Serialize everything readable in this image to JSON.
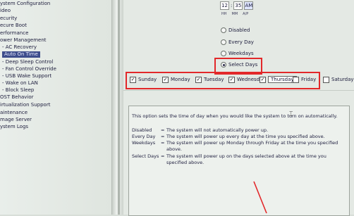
{
  "sidebar": {
    "items": [
      {
        "label": "ystem Configuration",
        "level": 0,
        "selected": false
      },
      {
        "label": "ideo",
        "level": 0,
        "selected": false
      },
      {
        "label": "ecurity",
        "level": 0,
        "selected": false
      },
      {
        "label": "ecure Boot",
        "level": 0,
        "selected": false
      },
      {
        "label": "erformance",
        "level": 0,
        "selected": false
      },
      {
        "label": "ower Management",
        "level": 0,
        "selected": false
      },
      {
        "label": "- AC Recovery",
        "level": 1,
        "selected": false
      },
      {
        "label": "Auto On Time",
        "level": 1,
        "selected": true
      },
      {
        "label": "- Deep Sleep Control",
        "level": 1,
        "selected": false
      },
      {
        "label": "- Fan Control Override",
        "level": 1,
        "selected": false
      },
      {
        "label": "- USB Wake Support",
        "level": 1,
        "selected": false
      },
      {
        "label": "- Wake on LAN",
        "level": 1,
        "selected": false
      },
      {
        "label": "- Block Sleep",
        "level": 1,
        "selected": false
      },
      {
        "label": "OST Behavior",
        "level": 0,
        "selected": false
      },
      {
        "label": "irtualization Support",
        "level": 0,
        "selected": false
      },
      {
        "label": "aintenance",
        "level": 0,
        "selected": false
      },
      {
        "label": "mage Server",
        "level": 0,
        "selected": false
      },
      {
        "label": "ystem Logs",
        "level": 0,
        "selected": false
      }
    ]
  },
  "time": {
    "hour": "12",
    "minute": "35",
    "ampm": "AM",
    "sep": ":",
    "labels": {
      "hh": "HH",
      "mm": "MM",
      "ap": "A/P"
    }
  },
  "radios": [
    {
      "label": "Disabled",
      "selected": false
    },
    {
      "label": "Every Day",
      "selected": false
    },
    {
      "label": "Weekdays",
      "selected": false
    },
    {
      "label": "Select Days",
      "selected": true
    }
  ],
  "days": [
    {
      "label": "Sunday",
      "checked": true
    },
    {
      "label": "Monday",
      "checked": true
    },
    {
      "label": "Tuesday",
      "checked": true
    },
    {
      "label": "Wednesday",
      "checked": true
    },
    {
      "label": "Thursday",
      "checked": true
    },
    {
      "label": "Friday",
      "checked": false
    },
    {
      "label": "Saturday",
      "checked": false
    }
  ],
  "check_mark": "✓",
  "help": {
    "intro": "This option sets the time of day when you would like the system to turn on automatically.",
    "equals": "=",
    "rows": [
      {
        "key": "Disabled",
        "text": "The system will not automatically power up."
      },
      {
        "key": "Every Day",
        "text": "The system will power up every day at the time you specified above."
      },
      {
        "key": "Weekdays",
        "text": "The system will power up Monday through Friday at the time you specified",
        "cont": "above."
      },
      {
        "key": "Select Days",
        "text": "The system will power up on the days selected above at the time you",
        "cont": "specified above."
      }
    ]
  },
  "colors": {
    "highlight": "#e2282a",
    "selected": "#3e4e8c"
  }
}
